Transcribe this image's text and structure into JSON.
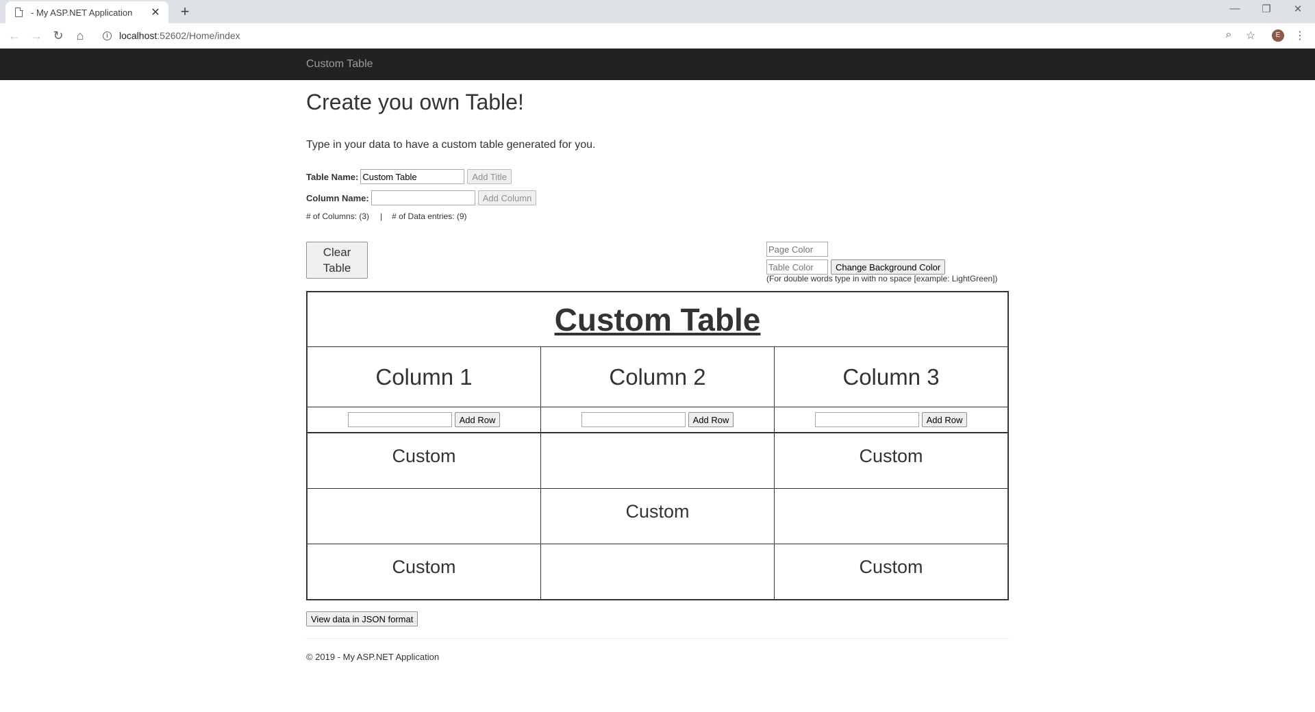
{
  "browser": {
    "tab_title": "- My ASP.NET Application",
    "tab_close": "✕",
    "new_tab": "+",
    "url_host": "localhost",
    "url_path": ":52602/Home/index",
    "profile_initial": "E",
    "window_controls": [
      "—",
      "❐",
      "✕"
    ]
  },
  "navbar": {
    "brand": "Custom Table"
  },
  "page": {
    "heading": "Create you own Table!",
    "lead": "Type in your data to have a custom table generated for you."
  },
  "form": {
    "table_name_label": "Table Name:",
    "table_name_value": "Custom Table",
    "add_title_label": "Add Title",
    "column_name_label": "Column Name:",
    "column_name_value": "",
    "add_column_label": "Add Column",
    "columns_count_text": "# of Columns: (3)",
    "separator": "|",
    "entries_count_text": "# of Data entries: (9)"
  },
  "controls": {
    "clear_line1": "Clear",
    "clear_line2": "Table",
    "page_color_placeholder": "Page Color",
    "table_color_placeholder": "Table Color",
    "change_bg_label": "Change Background Color",
    "note": "(For double words type in with no space [example: LightGreen])"
  },
  "table": {
    "title": "Custom Table",
    "columns": [
      "Column 1",
      "Column 2",
      "Column 3"
    ],
    "add_row_label": "Add Row",
    "rows": [
      [
        "Custom",
        "",
        "Custom"
      ],
      [
        "",
        "Custom",
        ""
      ],
      [
        "Custom",
        "",
        "Custom"
      ]
    ]
  },
  "json_button": "View data in JSON format",
  "footer": "© 2019 - My ASP.NET Application"
}
